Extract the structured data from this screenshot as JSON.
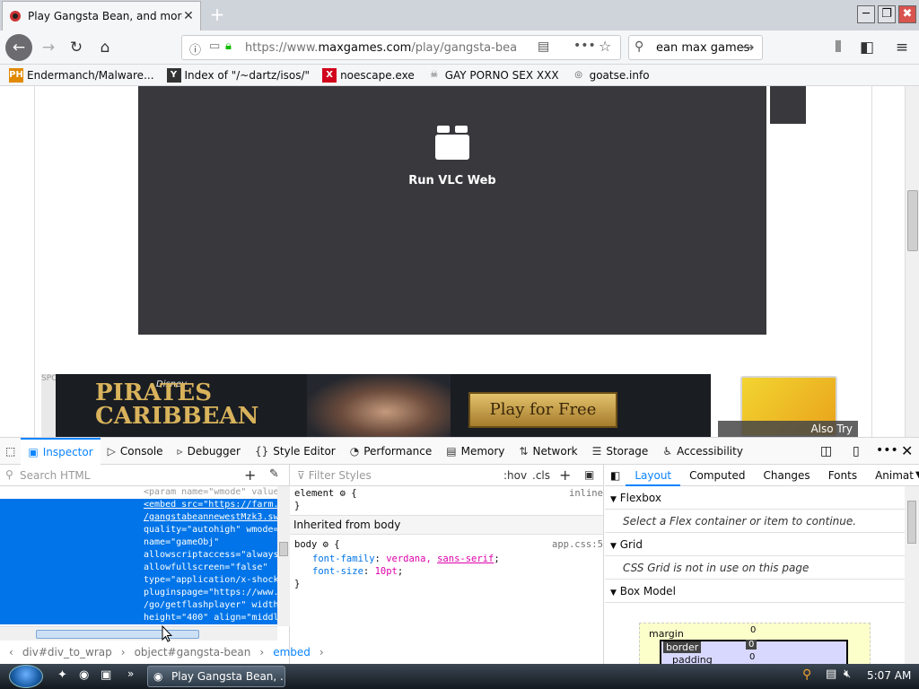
{
  "browser": {
    "tab_title": "Play Gangsta Bean, and more A",
    "url_prefix": "https://www.",
    "url_domain": "maxgames.com",
    "url_path": "/play/gangsta-bea",
    "search_text": "ean max games",
    "window_controls": {
      "minimize": "─",
      "maximize": "❐",
      "close": "✖"
    }
  },
  "bookmarks": [
    {
      "label": "Endermanch/Malware...",
      "icon": "PH",
      "color": "#e08a00"
    },
    {
      "label": "Index of \"/~dartz/isos/\"",
      "icon": "Y",
      "color": "#333333"
    },
    {
      "label": "noescape.exe",
      "icon": "X",
      "color": "#d0021b"
    },
    {
      "label": "GAY PORNO SEX XXX",
      "icon": "☠",
      "color": "#555555"
    },
    {
      "label": "goatse.info",
      "icon": "◎",
      "color": "#555555"
    }
  ],
  "page": {
    "vlc_label": "Run VLC Web",
    "sponsor_text": "SPONSO",
    "banner_brand": "Disney",
    "banner_title_1": "PIRATES",
    "banner_title_2": "CARIBBEAN",
    "banner_cta": "Play for Free",
    "also_try": "Also Try"
  },
  "devtools": {
    "tabs": [
      {
        "label": "Inspector",
        "icon": "▣",
        "selected": true
      },
      {
        "label": "Console",
        "icon": "▷"
      },
      {
        "label": "Debugger",
        "icon": "▹"
      },
      {
        "label": "Style Editor",
        "icon": "{}"
      },
      {
        "label": "Performance",
        "icon": "◔"
      },
      {
        "label": "Memory",
        "icon": "▤"
      },
      {
        "label": "Network",
        "icon": "⇅"
      },
      {
        "label": "Storage",
        "icon": "☰"
      },
      {
        "label": "Accessibility",
        "icon": "♿"
      }
    ],
    "search_placeholder": "Search HTML",
    "markup_lines": [
      "<param name=\"wmode\" value",
      "<embed src=\"https://farm.",
      "/gangstabeannewestMzk3.sw",
      "quality=\"autohigh\" wmode=",
      "name=\"gameObj\"",
      "allowscriptaccess=\"always",
      "allowfullscreen=\"false\"",
      "type=\"application/x-shock",
      "pluginspage=\"https://www.",
      "/go/getflashplayer\" width",
      "height=\"400\" align=\"middl"
    ],
    "breadcrumbs": [
      "div#div_to_wrap",
      "object#gangsta-bean",
      "embed"
    ],
    "filter_placeholder": "Filter Styles",
    "hov": ":hov",
    "cls": ".cls",
    "rules": {
      "element_selector": "element",
      "element_source": "inline",
      "inherited_header": "Inherited from body",
      "body_selector": "body",
      "body_source": "app.css:5",
      "prop1_name": "font-family",
      "prop1_value_a": "verdana,",
      "prop1_value_b": "sans-serif",
      "prop2_name": "font-size",
      "prop2_value": "10pt"
    },
    "layout_tabs": [
      "Layout",
      "Computed",
      "Changes",
      "Fonts",
      "Animat"
    ],
    "flexbox_title": "Flexbox",
    "flexbox_note": "Select a Flex container or item to continue.",
    "grid_title": "Grid",
    "grid_note": "CSS Grid is not in use on this page",
    "boxmodel_title": "Box Model",
    "box_margin_label": "margin",
    "box_margin_value": "0",
    "box_border_label": "border",
    "box_border_value": "0",
    "box_padding_label": "padding",
    "box_padding_value": "0"
  },
  "taskbar": {
    "task_label": "Play Gangsta Bean, ...",
    "clock": "5:07 AM"
  },
  "colors": {
    "accent": "#0a84ff",
    "selection": "#0074e8",
    "dark_panel": "#38383d"
  }
}
